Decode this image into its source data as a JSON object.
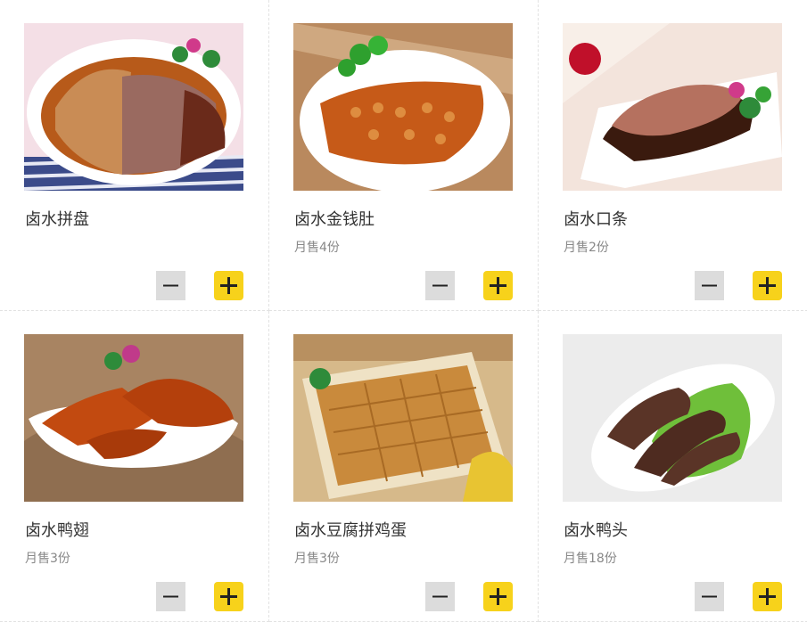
{
  "colors": {
    "accent_yellow": "#f7d21b",
    "minus_gray": "#dcdcdc",
    "text_dark": "#333333",
    "text_muted": "#888888"
  },
  "products": [
    {
      "name": "卤水拼盘",
      "sales": "",
      "image_icon": "braised-platter-image",
      "minus_icon": "minus-icon",
      "plus_icon": "plus-icon"
    },
    {
      "name": "卤水金钱肚",
      "sales": "月售4份",
      "image_icon": "honeycomb-tripe-image",
      "minus_icon": "minus-icon",
      "plus_icon": "plus-icon"
    },
    {
      "name": "卤水口条",
      "sales": "月售2份",
      "image_icon": "braised-tongue-image",
      "minus_icon": "minus-icon",
      "plus_icon": "plus-icon"
    },
    {
      "name": "卤水鸭翅",
      "sales": "月售3份",
      "image_icon": "duck-wings-image",
      "minus_icon": "minus-icon",
      "plus_icon": "plus-icon"
    },
    {
      "name": "卤水豆腐拼鸡蛋",
      "sales": "月售3份",
      "image_icon": "tofu-egg-image",
      "minus_icon": "minus-icon",
      "plus_icon": "plus-icon"
    },
    {
      "name": "卤水鸭头",
      "sales": "月售18份",
      "image_icon": "duck-head-image",
      "minus_icon": "minus-icon",
      "plus_icon": "plus-icon"
    }
  ]
}
